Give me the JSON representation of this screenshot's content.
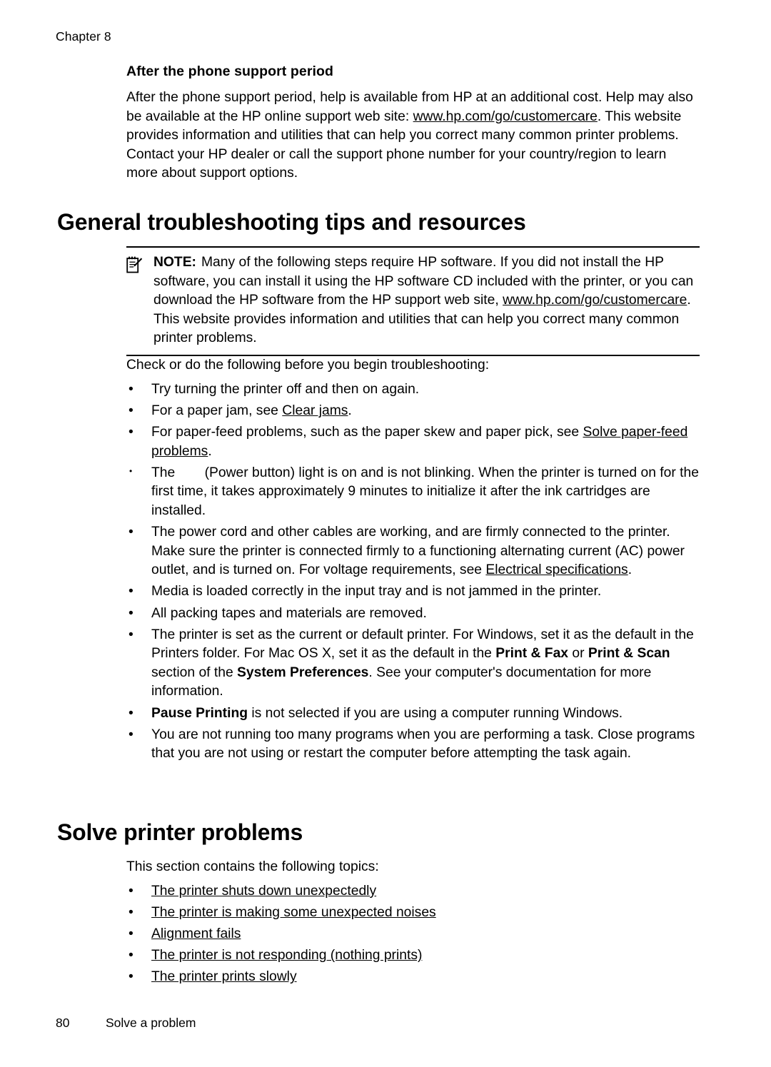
{
  "page": {
    "chapter_label": "Chapter 8",
    "footer_page_number": "80",
    "footer_section": "Solve a problem"
  },
  "sections": {
    "after_phone_support": {
      "heading": "After the phone support period",
      "paragraph_part1": "After the phone support period, help is available from HP at an additional cost. Help may also be available at the HP online support web site: ",
      "paragraph_link": "www.hp.com/go/customercare",
      "paragraph_part2": ". This website provides information and utilities that can help you correct many common printer problems. Contact your HP dealer or call the support phone number for your country/region to learn more about support options."
    },
    "general_troubleshooting": {
      "title": "General troubleshooting tips and resources",
      "note": {
        "icon": "note-pencil-icon",
        "label": "NOTE:",
        "text_part1": "Many of the following steps require HP software. If you did not install the HP software, you can install it using the HP software CD included with the printer, or you can download the HP software from the HP support web site, ",
        "link": "www.hp.com/go/customercare",
        "text_part2": ". This website provides information and utilities that can help you correct many common printer problems."
      },
      "lead_in": "Check or do the following before you begin troubleshooting:",
      "bullets": [
        {
          "id": "power-cycle",
          "text": "Try turning the printer off and then on again."
        },
        {
          "id": "paper-jam",
          "prefix": "For a paper jam, see ",
          "link": "Clear jams",
          "suffix": "."
        },
        {
          "id": "paper-feed",
          "prefix": "For paper-feed problems, such as the paper skew and paper pick, see ",
          "link": "Solve paper-feed problems",
          "suffix": "."
        },
        {
          "id": "power-button-light",
          "prefix": "The ",
          "icon": "power-button-icon",
          "suffix": "(Power button) light is on and is not blinking. When the printer is turned on for the first time, it takes approximately 9 minutes to initialize it after the ink cartridges are installed."
        },
        {
          "id": "power-cord",
          "prefix": "The power cord and other cables are working, and are firmly connected to the printer. Make sure the printer is connected firmly to a functioning alternating current (AC) power outlet, and is turned on. For voltage requirements, see ",
          "link": "Electrical specifications",
          "suffix": "."
        },
        {
          "id": "media-loaded",
          "text": "Media is loaded correctly in the input tray and is not jammed in the printer."
        },
        {
          "id": "packing-removed",
          "text": "All packing tapes and materials are removed."
        },
        {
          "id": "default-printer",
          "rich": [
            {
              "t": "The printer is set as the current or default printer. For Windows, set it as the default in the Printers folder. For Mac OS X, set it as the default in the "
            },
            {
              "t": "Print & Fax",
              "b": true
            },
            {
              "t": " or "
            },
            {
              "t": "Print & Scan",
              "b": true
            },
            {
              "t": " section of the "
            },
            {
              "t": "System Preferences",
              "b": true
            },
            {
              "t": ". See your computer's documentation for more information."
            }
          ]
        },
        {
          "id": "pause-printing",
          "rich": [
            {
              "t": "Pause Printing",
              "b": true
            },
            {
              "t": " is not selected if you are using a computer running Windows."
            }
          ]
        },
        {
          "id": "too-many-programs",
          "text": "You are not running too many programs when you are performing a task. Close programs that you are not using or restart the computer before attempting the task again."
        }
      ]
    },
    "solve_printer_problems": {
      "title": "Solve printer problems",
      "lead_in": "This section contains the following topics:",
      "topics": [
        "The printer shuts down unexpectedly",
        "The printer is making some unexpected noises",
        "Alignment fails",
        "The printer is not responding (nothing prints)",
        "The printer prints slowly"
      ]
    }
  },
  "colors": {
    "text": "#000000",
    "background": "#ffffff",
    "rule": "#000000"
  }
}
